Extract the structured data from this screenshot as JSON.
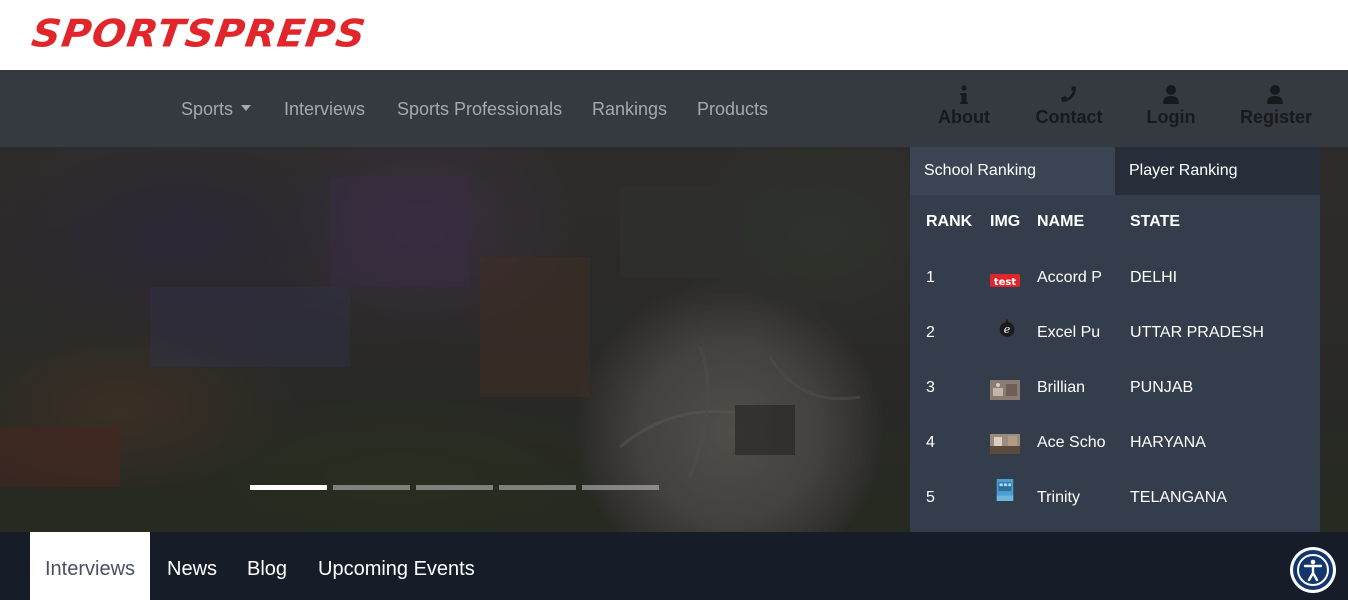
{
  "brand": {
    "logo_text": "SPORTSPREPS",
    "logo_color": "#e0262a"
  },
  "nav": {
    "links": [
      "Sports",
      "Interviews",
      "Sports Professionals",
      "Rankings",
      "Products"
    ],
    "icon_links": [
      {
        "label": "About",
        "icon": "info-icon"
      },
      {
        "label": "Contact",
        "icon": "phone-icon"
      },
      {
        "label": "Login",
        "icon": "user-icon"
      },
      {
        "label": "Register",
        "icon": "user-icon"
      }
    ]
  },
  "hero": {
    "slides_count": 5,
    "active_slide": 1
  },
  "ranking": {
    "tabs": [
      "School Ranking",
      "Player Ranking"
    ],
    "active_tab": "School Ranking",
    "columns": [
      "RANK",
      "IMG",
      "NAME",
      "STATE"
    ],
    "rows": [
      {
        "rank": "1",
        "img": "test-logo-icon",
        "name": "Accord P",
        "state": "DELHI"
      },
      {
        "rank": "2",
        "img": "e-logo-icon",
        "name": "Excel Pu",
        "state": "UTTAR PRADESH"
      },
      {
        "rank": "3",
        "img": "school-photo-icon",
        "name": "Brillian",
        "state": "PUNJAB"
      },
      {
        "rank": "4",
        "img": "school-photo-icon",
        "name": "Ace Scho",
        "state": "HARYANA"
      },
      {
        "rank": "5",
        "img": "school-building-icon",
        "name": "Trinity",
        "state": "TELANGANA"
      }
    ]
  },
  "bottom_tabs": {
    "items": [
      "Interviews",
      "News",
      "Blog",
      "Upcoming Events"
    ],
    "active": "Interviews"
  },
  "accessibility": {
    "icon": "accessibility-icon",
    "accent": "#14366e"
  }
}
